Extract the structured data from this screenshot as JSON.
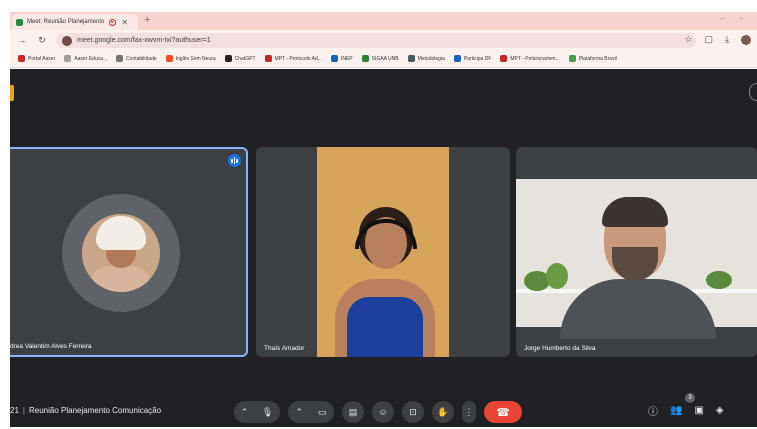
{
  "browser": {
    "tab_title": "Meet: Reunião Planejamento",
    "new_tab": "+",
    "url": "meet.google.com/fax-xwvm-txi?authuser=1",
    "bookmarks": [
      {
        "label": "Portal Aaser",
        "color": "#c62828"
      },
      {
        "label": "Aaser Educa...",
        "color": "#9e9e9e"
      },
      {
        "label": "Contabilidade",
        "color": "#757575"
      },
      {
        "label": "Inglês Sem Neura",
        "color": "#f4511e"
      },
      {
        "label": "ChatGPT",
        "color": "#212121"
      },
      {
        "label": "MPT - Protocolo Ad...",
        "color": "#c62828"
      },
      {
        "label": "INEP",
        "color": "#1565c0"
      },
      {
        "label": "SIGAA UNB",
        "color": "#2e7d32"
      },
      {
        "label": "Metodologia",
        "color": "#455a64"
      },
      {
        "label": "Participa DF",
        "color": "#1565c0"
      },
      {
        "label": "MPT - Peticionamen...",
        "color": "#c62828"
      },
      {
        "label": "Plataforma Brasil",
        "color": "#43a047"
      }
    ]
  },
  "participants": [
    {
      "name": "drea Valentim Alves Ferreira",
      "speaking": true
    },
    {
      "name": "Thaís Amador",
      "speaking": false
    },
    {
      "name": "Jorge Humberto da Silva",
      "speaking": false
    }
  ],
  "meeting": {
    "time": "21",
    "separator": "|",
    "title": "Reunião Planejamento Comunicação"
  },
  "people_count": "3",
  "colors": {
    "accent": "#8ab4f8",
    "speaking": "#1a73e8",
    "leave": "#ea4335",
    "background": "#202124"
  }
}
